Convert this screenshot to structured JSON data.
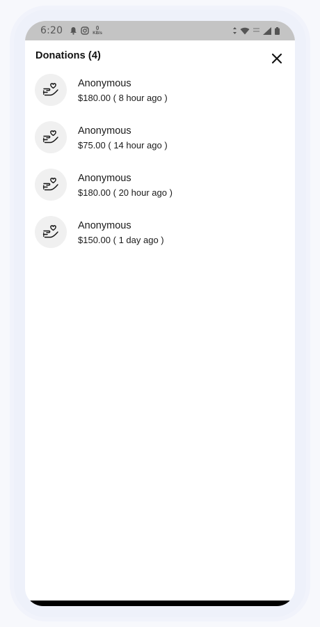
{
  "status_bar": {
    "time": "6:20",
    "data_rate_value": "0",
    "data_rate_unit": "KB/s",
    "icons_left": [
      "bell-icon",
      "instagram-icon",
      "data-rate-icon"
    ],
    "icons_right": [
      "data-arrows-icon",
      "wifi-icon",
      "signal-icon",
      "battery-icon"
    ]
  },
  "header": {
    "title": "Donations (4)",
    "close_icon": "close-icon"
  },
  "donations": [
    {
      "name": "Anonymous",
      "amount": "$180.00",
      "time": "( 8 hour ago )",
      "icon": "donate-hand-heart-icon"
    },
    {
      "name": "Anonymous",
      "amount": "$75.00",
      "time": "( 14 hour ago )",
      "icon": "donate-hand-heart-icon"
    },
    {
      "name": "Anonymous",
      "amount": "$180.00",
      "time": "( 20 hour ago )",
      "icon": "donate-hand-heart-icon"
    },
    {
      "name": "Anonymous",
      "amount": "$150.00",
      "time": "( 1 day ago )",
      "icon": "donate-hand-heart-icon"
    }
  ],
  "colors": {
    "status_bar_bg": "#c4c4c4",
    "avatar_bg": "#f0f0f0",
    "text": "#1a1a1a"
  }
}
